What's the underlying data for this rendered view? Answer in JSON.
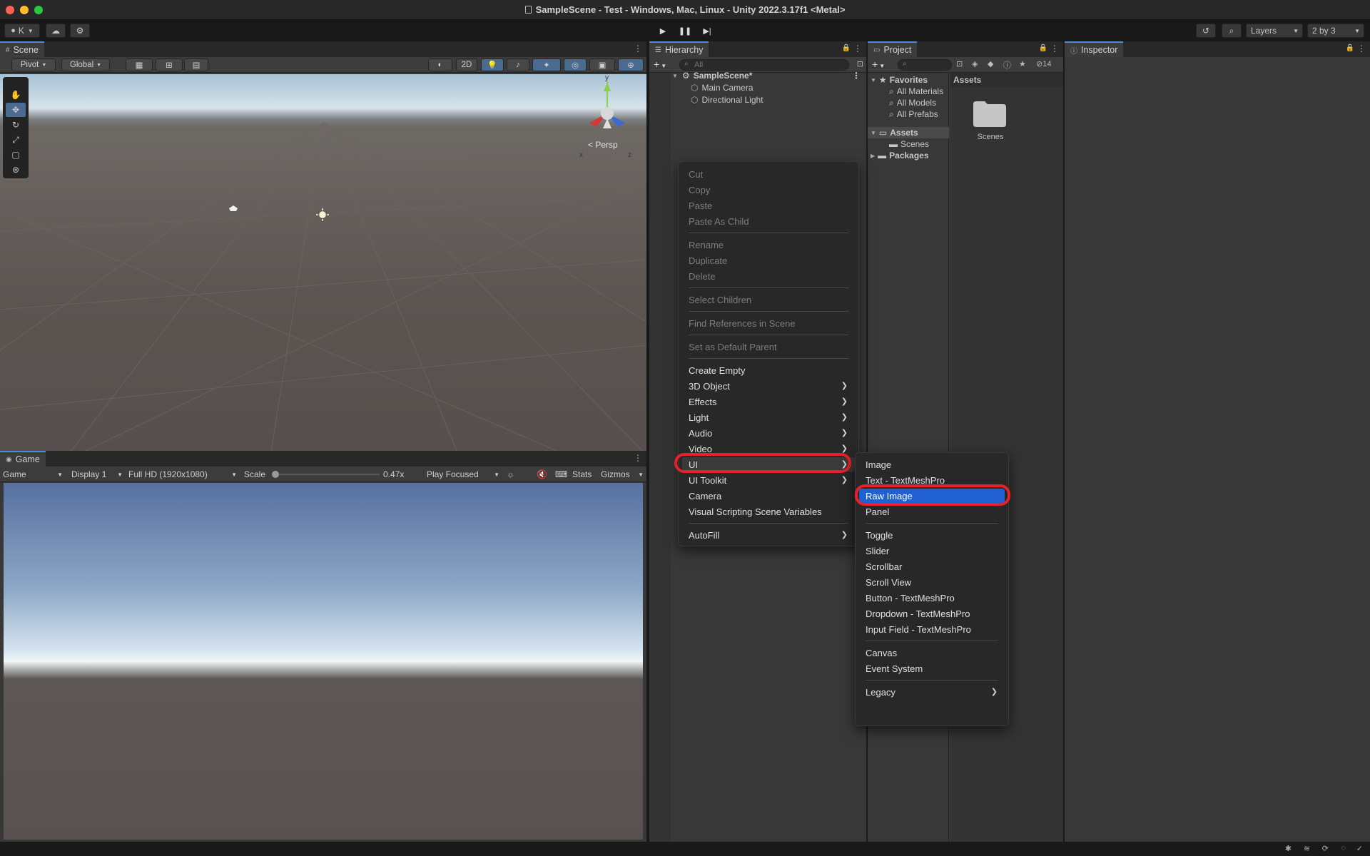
{
  "window": {
    "title": "SampleScene - Test - Windows, Mac, Linux - Unity 2022.3.17f1 <Metal>"
  },
  "toolbar": {
    "account": "K",
    "layers": "Layers",
    "layout": "2 by 3"
  },
  "scene": {
    "tab": "Scene",
    "pivot": "Pivot",
    "global": "Global",
    "mode2d": "2D",
    "persp": "< Persp",
    "axis_x": "x",
    "axis_y": "y",
    "axis_z": "z"
  },
  "game": {
    "tab": "Game",
    "mode": "Game",
    "display": "Display 1",
    "resolution": "Full HD (1920x1080)",
    "scale_label": "Scale",
    "scale_value": "0.47x",
    "play_focused": "Play Focused",
    "stats": "Stats",
    "gizmos": "Gizmos"
  },
  "hierarchy": {
    "tab": "Hierarchy",
    "search_placeholder": "All",
    "scene_name": "SampleScene*",
    "items": [
      "Main Camera",
      "Directional Light"
    ]
  },
  "project": {
    "tab": "Project",
    "hidden_count": "14",
    "favorites_label": "Favorites",
    "favorites": [
      "All Materials",
      "All Models",
      "All Prefabs"
    ],
    "assets_label": "Assets",
    "assets_children": [
      "Scenes"
    ],
    "packages_label": "Packages",
    "breadcrumb": "Assets",
    "grid_items": [
      "Scenes"
    ]
  },
  "inspector": {
    "tab": "Inspector"
  },
  "context_menu": {
    "items": [
      {
        "label": "Cut"
      },
      {
        "label": "Copy"
      },
      {
        "label": "Paste"
      },
      {
        "label": "Paste As Child"
      },
      {
        "label": "Rename"
      },
      {
        "label": "Duplicate"
      },
      {
        "label": "Delete"
      },
      {
        "label": "Select Children"
      },
      {
        "label": "Find References in Scene"
      },
      {
        "label": "Set as Default Parent"
      },
      {
        "label": "Create Empty"
      },
      {
        "label": "3D Object"
      },
      {
        "label": "Effects"
      },
      {
        "label": "Light"
      },
      {
        "label": "Audio"
      },
      {
        "label": "Video"
      },
      {
        "label": "UI"
      },
      {
        "label": "UI Toolkit"
      },
      {
        "label": "Camera"
      },
      {
        "label": "Visual Scripting Scene Variables"
      },
      {
        "label": "AutoFill"
      }
    ]
  },
  "ui_submenu": {
    "items": [
      {
        "label": "Image"
      },
      {
        "label": "Text - TextMeshPro"
      },
      {
        "label": "Raw Image"
      },
      {
        "label": "Panel"
      },
      {
        "label": "Toggle"
      },
      {
        "label": "Slider"
      },
      {
        "label": "Scrollbar"
      },
      {
        "label": "Scroll View"
      },
      {
        "label": "Button - TextMeshPro"
      },
      {
        "label": "Dropdown - TextMeshPro"
      },
      {
        "label": "Input Field - TextMeshPro"
      },
      {
        "label": "Canvas"
      },
      {
        "label": "Event System"
      },
      {
        "label": "Legacy"
      }
    ]
  },
  "colors": {
    "highlight": "#2060d0",
    "annotation": "#e8202a",
    "tab_accent": "#4a8bd8"
  }
}
